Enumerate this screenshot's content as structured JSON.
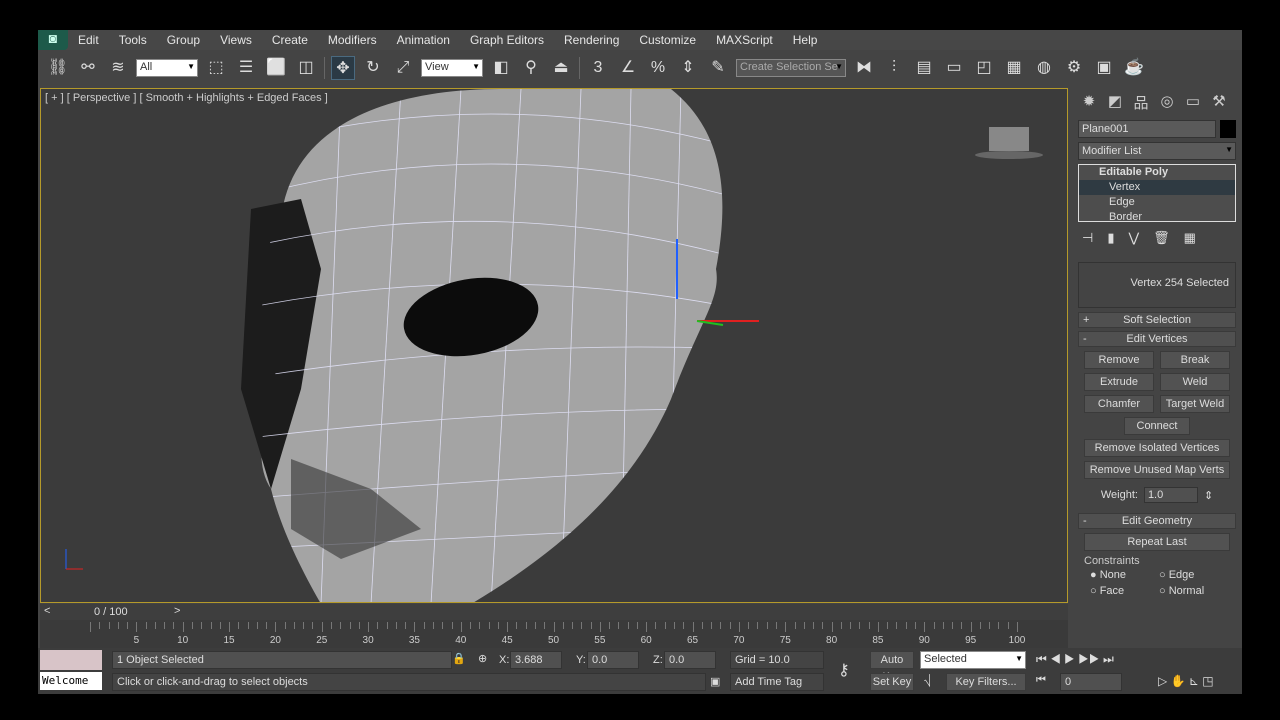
{
  "menu": [
    "Edit",
    "Tools",
    "Group",
    "Views",
    "Create",
    "Modifiers",
    "Animation",
    "Graph Editors",
    "Rendering",
    "Customize",
    "MAXScript",
    "Help"
  ],
  "toolbar": {
    "filter": "All",
    "ref_coord": "View",
    "selection_set": "Create Selection Se"
  },
  "viewport": {
    "label": "[ + ] [ Perspective ] [ Smooth + Highlights + Edged Faces ]"
  },
  "command_panel": {
    "object_name": "Plane001",
    "modifier_list": "Modifier List",
    "stack": [
      "Editable Poly",
      "Vertex",
      "Edge",
      "Border"
    ],
    "selection_info": "Vertex 254 Selected",
    "soft_selection": "Soft Selection",
    "edit_vertices": "Edit Vertices",
    "buttons": {
      "remove": "Remove",
      "break": "Break",
      "extrude": "Extrude",
      "weld": "Weld",
      "chamfer": "Chamfer",
      "target_weld": "Target Weld",
      "connect": "Connect",
      "remove_isolated": "Remove Isolated Vertices",
      "remove_unused": "Remove Unused Map Verts"
    },
    "weight_label": "Weight:",
    "weight_value": "1.0",
    "edit_geometry": "Edit Geometry",
    "repeat_last": "Repeat Last",
    "constraints": "Constraints",
    "constraint_options": [
      "None",
      "Edge",
      "Face",
      "Normal"
    ]
  },
  "timeline": {
    "frame": "0 / 100",
    "ticks": [
      "5",
      "10",
      "15",
      "20",
      "25",
      "30",
      "35",
      "40",
      "45",
      "50",
      "55",
      "60",
      "65",
      "70",
      "75",
      "80",
      "85",
      "90",
      "95",
      "100"
    ]
  },
  "status": {
    "welcome": "Welcome",
    "selected": "1 Object Selected",
    "prompt": "Click or click-and-drag to select objects",
    "x_label": "X:",
    "x": "3.688",
    "y_label": "Y:",
    "y": "0.0",
    "z_label": "Z:",
    "z": "0.0",
    "grid": "Grid = 10.0",
    "add_time_tag": "Add Time Tag",
    "auto_key": "Auto Key",
    "set_key": "Set Key",
    "key_mode": "Selected",
    "key_filters": "Key Filters...",
    "frame_field": "0"
  }
}
